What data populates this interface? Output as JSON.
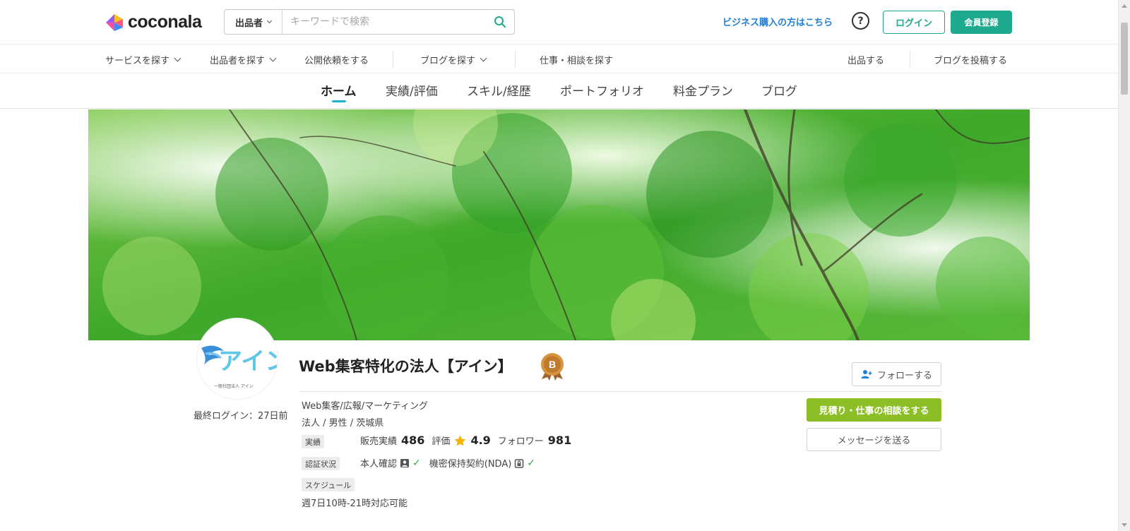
{
  "header": {
    "logo_text": "coconala",
    "search_category": "出品者",
    "search_placeholder": "キーワードで検索",
    "business_link": "ビジネス購入の方はこちら",
    "help_symbol": "?",
    "login_label": "ログイン",
    "register_label": "会員登録"
  },
  "subnav": {
    "find_services": "サービスを探す",
    "find_sellers": "出品者を探す",
    "public_requests": "公開依頼をする",
    "find_blogs": "ブログを探す",
    "find_jobs": "仕事・相談を探す",
    "list_service": "出品する",
    "post_blog": "ブログを投稿する"
  },
  "tabs": [
    {
      "label": "ホーム",
      "active": true
    },
    {
      "label": "実績/評価",
      "active": false
    },
    {
      "label": "スキル/経歴",
      "active": false
    },
    {
      "label": "ポートフォリオ",
      "active": false
    },
    {
      "label": "料金プラン",
      "active": false
    },
    {
      "label": "ブログ",
      "active": false
    }
  ],
  "profile": {
    "avatar_logo_text": "アイン",
    "avatar_caption": "一般社団法人 アイン",
    "last_login": "最終ログイン：27日前",
    "name": "Web集客特化の法人【アイン】",
    "rank_badge": "B",
    "category": "Web集客/広報/マーケティング",
    "attributes": "法人 /  男性 /  茨城県",
    "tag_record": "実績",
    "sales_label": "販売実績",
    "sales_value": "486",
    "rating_label": "評価",
    "rating_value": "4.9",
    "followers_label": "フォロワー",
    "followers_value": "981",
    "tag_verification": "認証状況",
    "identity_label": "本人確認",
    "nda_label": "機密保持契約(NDA)",
    "tag_schedule": "スケジュール",
    "schedule_text": "週7日10時-21時対応可能"
  },
  "actions": {
    "follow_label": "フォローする",
    "consult_label": "見積り・仕事の相談をする",
    "message_label": "メッセージを送る"
  },
  "colors": {
    "brand_teal": "#1eaa8e",
    "link_blue": "#1f7fd6",
    "consult_green": "#8cbf26",
    "tab_accent": "#1fb2d6",
    "badge_bronze": "#c98a3a",
    "star": "#f4b400",
    "check": "#2aa84a"
  }
}
